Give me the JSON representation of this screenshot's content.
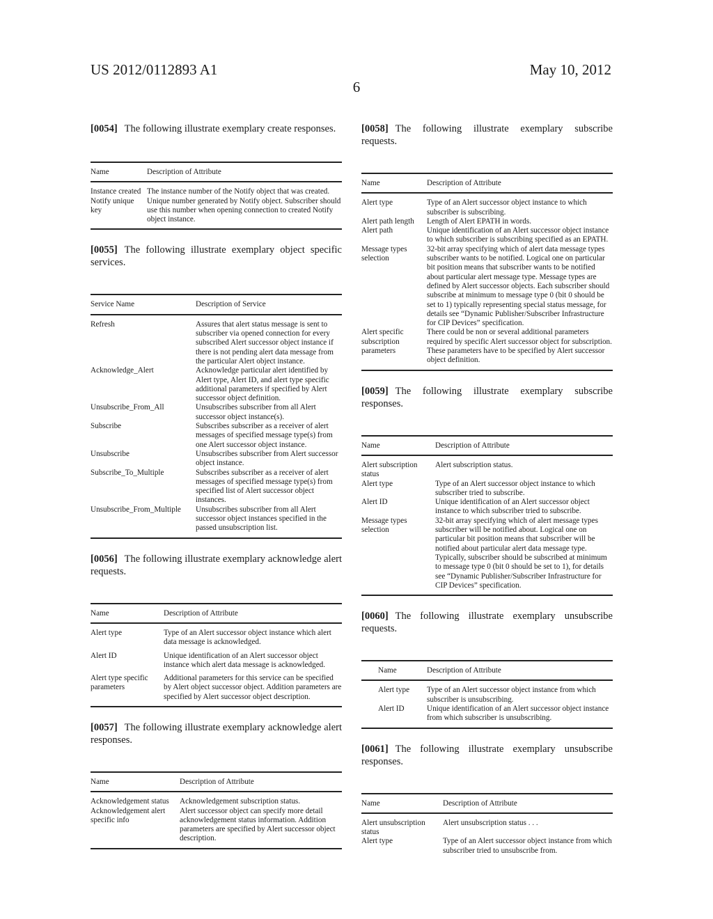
{
  "header": {
    "publication_number": "US 2012/0112893 A1",
    "date": "May 10, 2012",
    "page_number": "6"
  },
  "left_column": {
    "p0054": {
      "num": "[0054]",
      "text": "The following illustrate exemplary create responses."
    },
    "table_create_responses": {
      "headers": [
        "Name",
        "Description of Attribute"
      ],
      "rows": [
        {
          "name": "Instance created",
          "desc": "The instance number of the Notify object that was created."
        },
        {
          "name": "Notify unique key",
          "desc": "Unique number generated by Notify object. Subscriber should use this number when opening connection to created Notify object instance."
        }
      ]
    },
    "p0055": {
      "num": "[0055]",
      "text": "The following illustrate exemplary object specific services."
    },
    "table_services": {
      "headers": [
        "Service Name",
        "Description of Service"
      ],
      "rows": [
        {
          "name": "Refresh",
          "desc": "Assures that alert status message is sent to subscriber via opened connection for every subscribed Alert successor object instance if there is not pending alert data message from the particular Alert object instance."
        },
        {
          "name": "Acknowledge_Alert",
          "desc": "Acknowledge particular alert identified by Alert type, Alert ID, and alert type specific additional parameters if specified by Alert successor object definition."
        },
        {
          "name": "Unsubscribe_From_All",
          "desc": "Unsubscribes subscriber from all Alert successor object instance(s)."
        },
        {
          "name": "Subscribe",
          "desc": "Subscribes subscriber as a receiver of alert messages of specified message type(s) from one Alert successor object instance."
        },
        {
          "name": "Unsubscribe",
          "desc": "Unsubscribes subscriber from Alert successor object instance."
        },
        {
          "name": "Subscribe_To_Multiple",
          "desc": "Subscribes subscriber as a receiver of alert messages of specified message type(s) from specified list of Alert successor object instances."
        },
        {
          "name": "Unsubscribe_From_Multiple",
          "desc": "Unsubscribes subscriber from all Alert successor object instances specified in the passed unsubscription list."
        }
      ]
    },
    "p0056": {
      "num": "[0056]",
      "text": "The following illustrate exemplary acknowledge alert requests."
    },
    "table_ack_requests": {
      "headers": [
        "Name",
        "Description of Attribute"
      ],
      "rows": [
        {
          "name": "Alert type",
          "desc": "Type of an Alert successor object instance which alert data message is acknowledged."
        },
        {
          "name": "Alert ID",
          "desc": "Unique identification of an Alert successor object instance which alert data message is acknowledged."
        },
        {
          "name": "Alert type specific parameters",
          "desc": "Additional parameters for this service can be specified by Alert object successor object. Addition parameters are specified by Alert successor object description."
        }
      ]
    },
    "p0057": {
      "num": "[0057]",
      "text": "The following illustrate exemplary acknowledge alert responses."
    },
    "table_ack_responses": {
      "headers": [
        "Name",
        "Description of Attribute"
      ],
      "rows": [
        {
          "name": "Acknowledgement status",
          "desc": "Acknowledgement subscription status."
        },
        {
          "name": "Acknowledgement alert specific info",
          "desc": "Alert successor object can specify more detail acknowledgement status information. Addition parameters are specified by Alert successor object description."
        }
      ]
    }
  },
  "right_column": {
    "p0058": {
      "num": "[0058]",
      "text": "The following illustrate exemplary subscribe requests."
    },
    "table_subscribe_requests": {
      "headers": [
        "Name",
        "Description of Attribute"
      ],
      "rows": [
        {
          "name": "Alert type",
          "desc": "Type of an Alert successor object instance to which subscriber is subscribing."
        },
        {
          "name": "Alert path length",
          "desc": "Length of Alert EPATH in words."
        },
        {
          "name": "Alert path",
          "desc": "Unique identification of an Alert successor object instance to which subscriber is subscribing specified as an EPATH."
        },
        {
          "name": "Message types selection",
          "desc": "32-bit array specifying which of alert data message types subscriber wants to be notified. Logical one on particular bit position means that subscriber wants to be notified about particular alert message type. Message types are defined by Alert successor objects. Each subscriber should subscribe at minimum to message type 0 (bit 0 should be set to 1) typically representing special status message, for details see “Dynamic Publisher/Subscriber Infrastructure for CIP Devices” specification."
        },
        {
          "name": "Alert specific subscription parameters",
          "desc": "There could be non or several additional parameters required by specific Alert successor object for subscription. These parameters have to be specified by Alert successor object definition."
        }
      ]
    },
    "p0059": {
      "num": "[0059]",
      "text": "The following illustrate exemplary subscribe responses."
    },
    "table_subscribe_responses": {
      "headers": [
        "Name",
        "Description of Attribute"
      ],
      "rows": [
        {
          "name": "Alert subscription status",
          "desc": "Alert subscription status."
        },
        {
          "name": "Alert type",
          "desc": "Type of an Alert successor object instance to which subscriber tried to subscribe."
        },
        {
          "name": "Alert ID",
          "desc": "Unique identification of an Alert successor object instance to which subscriber tried to subscribe."
        },
        {
          "name": "Message types selection",
          "desc": "32-bit array specifying which of alert message types subscriber will be notified about. Logical one on particular bit position means that subscriber will be notified about particular alert data message type. Typically, subscriber should be subscribed at minimum to message type 0 (bit 0 should be set to 1), for details see “Dynamic Publisher/Subscriber Infrastructure for CIP Devices” specification."
        }
      ]
    },
    "p0060": {
      "num": "[0060]",
      "text": "The following illustrate exemplary unsubscribe requests."
    },
    "table_unsubscribe_requests": {
      "headers": [
        "Name",
        "Description of Attribute"
      ],
      "rows": [
        {
          "name": "Alert type",
          "desc": "Type of an Alert successor object instance from which subscriber is unsubscribing."
        },
        {
          "name": "Alert ID",
          "desc": "Unique identification of an Alert successor object instance from which subscriber is unsubscribing."
        }
      ]
    },
    "p0061": {
      "num": "[0061]",
      "text": "The following illustrate exemplary unsubscribe responses."
    },
    "table_unsubscribe_responses": {
      "headers": [
        "Name",
        "Description of Attribute"
      ],
      "rows": [
        {
          "name": "Alert unsubscription status",
          "desc": "Alert unsubscription status . . ."
        },
        {
          "name": "Alert type",
          "desc": "Type of an Alert successor object instance from which subscriber tried to unsubscribe from."
        }
      ]
    }
  }
}
